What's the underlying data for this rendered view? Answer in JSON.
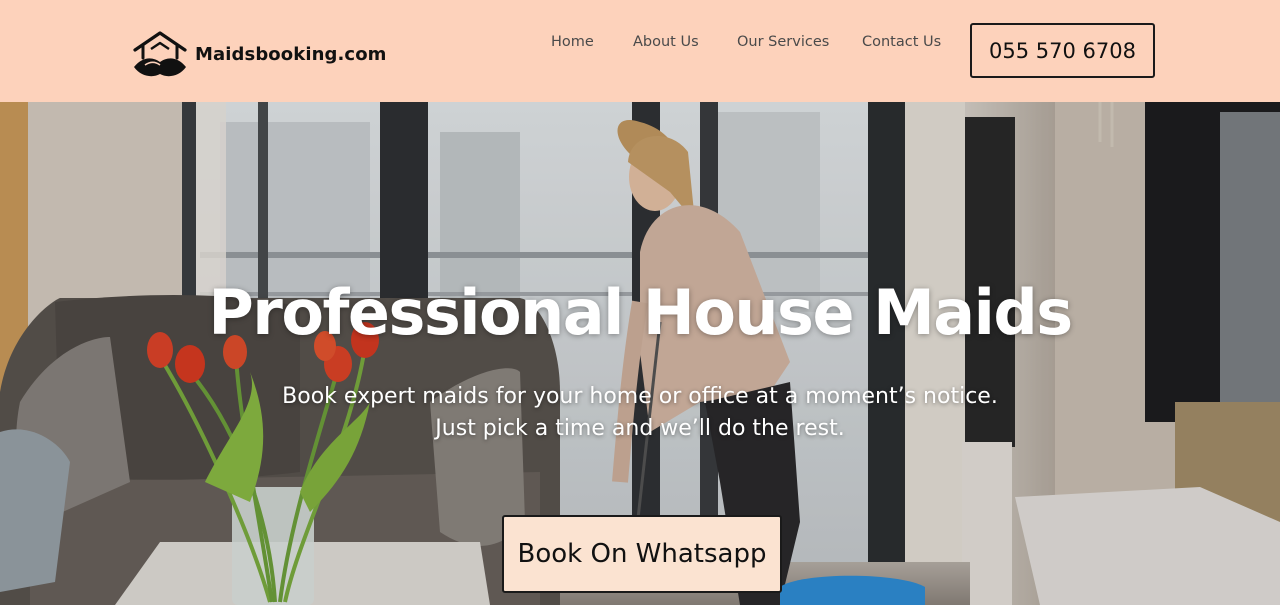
{
  "brand": {
    "name": "Maidsbooking.com"
  },
  "nav": {
    "items": [
      {
        "label": "Home"
      },
      {
        "label": "About Us"
      },
      {
        "label": "Our Services"
      },
      {
        "label": "Contact Us"
      }
    ],
    "phone_label": "055 570 6708"
  },
  "hero": {
    "title": "Professional House Maids",
    "subtitle_line1": "Book expert maids for your home or office at a moment’s notice.",
    "subtitle_line2": "Just pick a time and we’ll do the rest.",
    "cta_label": "Book On Whatsapp"
  },
  "colors": {
    "header_bg": "#fdd2bb",
    "cta_bg": "#fbe3d1",
    "text_dark": "#111111"
  },
  "icons": {
    "logo": "house-hands-icon"
  }
}
